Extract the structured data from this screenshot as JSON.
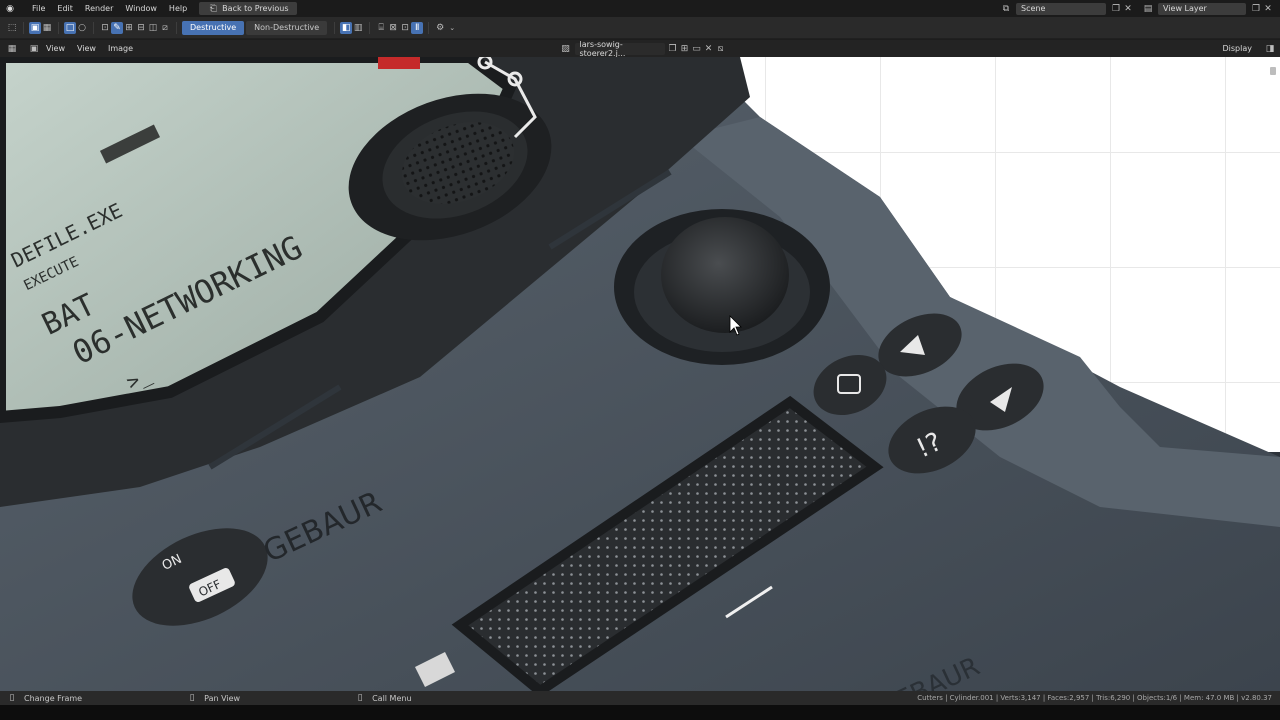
{
  "topbar": {
    "menus": [
      "File",
      "Edit",
      "Render",
      "Window",
      "Help"
    ],
    "back_button": "Back to Previous",
    "scene_name": "Scene",
    "view_layer": "View Layer"
  },
  "toolbar": {
    "destructive": "Destructive",
    "non_destructive": "Non-Destructive"
  },
  "editor_header": {
    "view1": "View",
    "view2": "View",
    "image": "Image",
    "image_name": "lars-sowig-stoerer2.j...",
    "display": "Display"
  },
  "image_text": {
    "lcd_line1": "DEFILE.EXE",
    "lcd_line2": "EXECUTE",
    "lcd_line3": "BAT",
    "lcd_line4": "06-NETWORKING",
    "lcd_prompt": ">_",
    "brand": "GEBAUR",
    "brand2": "EBAUR",
    "on_label": "ON",
    "off_label": "OFF"
  },
  "statusbar": {
    "left1": "Change Frame",
    "left2": "Pan View",
    "left3": "Call Menu",
    "stats": "Cutters | Cylinder.001 | Verts:3,147 | Faces:2,957 | Tris:6,290 | Objects:1/6 | Mem: 47.0 MB | v2.80.37"
  },
  "colors": {
    "accent": "#4772b3",
    "device_body": "#4b545e",
    "lcd": "#b4c4bb"
  }
}
